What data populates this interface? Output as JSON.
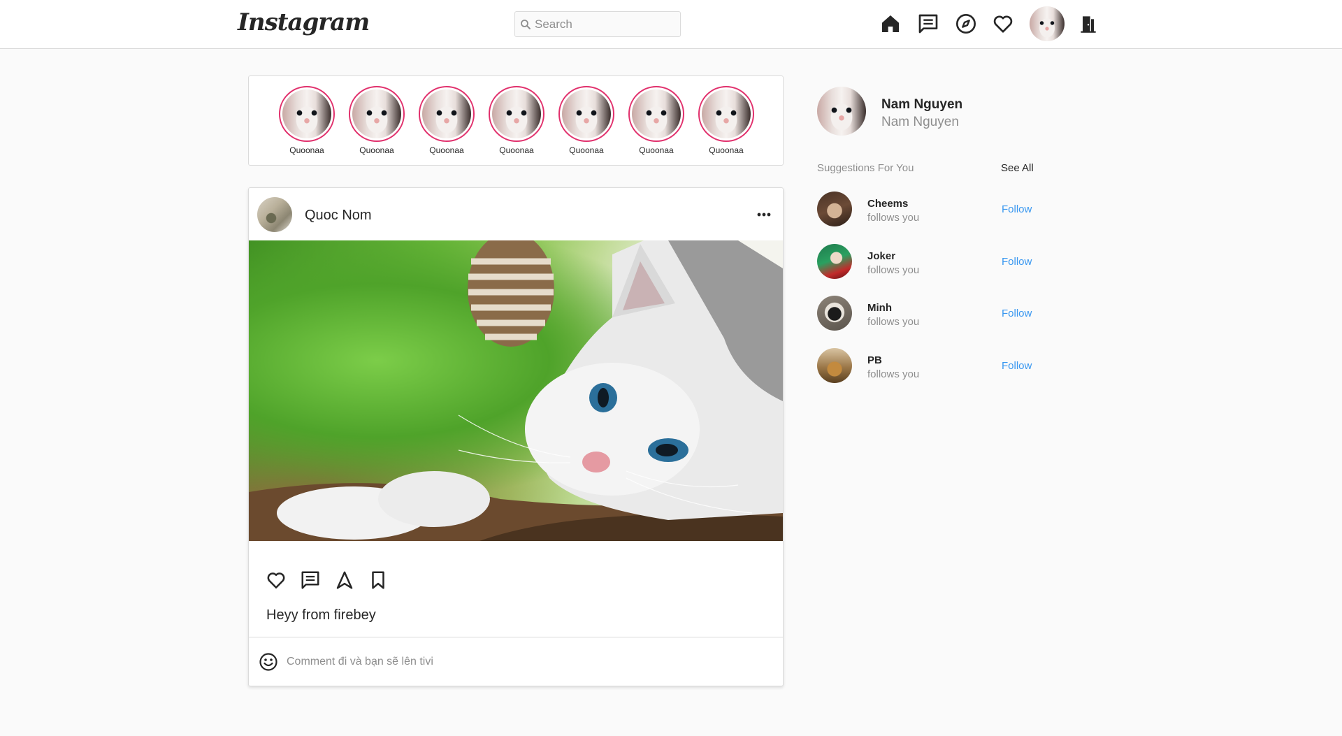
{
  "header": {
    "logo_text": "Instagram",
    "search_placeholder": "Search",
    "nav_icons": [
      "home-icon",
      "messages-icon",
      "explore-icon",
      "activity-heart-icon",
      "profile-avatar",
      "logout-door-icon"
    ]
  },
  "stories": {
    "items": [
      {
        "name": "Quoonaa"
      },
      {
        "name": "Quoonaa"
      },
      {
        "name": "Quoonaa"
      },
      {
        "name": "Quoonaa"
      },
      {
        "name": "Quoonaa"
      },
      {
        "name": "Quoonaa"
      },
      {
        "name": "Quoonaa"
      }
    ]
  },
  "post": {
    "username": "Quoc Nom",
    "caption": "Heyy from firebey",
    "comment_placeholder": "Comment đi và bạn sẽ lên tivi",
    "action_icons": [
      "heart-icon",
      "comment-icon",
      "share-icon",
      "bookmark-icon"
    ]
  },
  "sidebar": {
    "username": "Nam Nguyen",
    "fullname": "Nam Nguyen",
    "suggestions_title": "Suggestions For You",
    "see_all": "See All",
    "suggestions": [
      {
        "name": "Cheems",
        "subtitle": "follows you",
        "action": "Follow"
      },
      {
        "name": "Joker",
        "subtitle": "follows you",
        "action": "Follow"
      },
      {
        "name": "Minh",
        "subtitle": "follows you",
        "action": "Follow"
      },
      {
        "name": "PB",
        "subtitle": "follows you",
        "action": "Follow"
      }
    ]
  },
  "colors": {
    "background": "#fafafa",
    "border": "#dbdbdb",
    "text": "#262626",
    "muted": "#8e8e8e",
    "link_blue": "#3897f0",
    "story_ring": "#e1306c"
  }
}
